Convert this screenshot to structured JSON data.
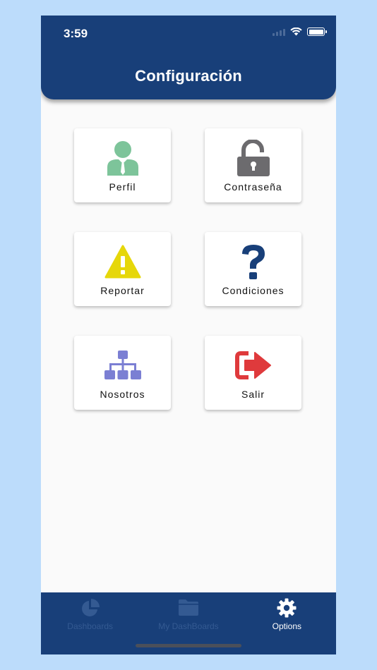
{
  "status_bar": {
    "time": "3:59"
  },
  "header": {
    "title": "Configuración"
  },
  "menu": [
    {
      "label": "Perfil",
      "icon": "user-icon",
      "color": "#7dc49a"
    },
    {
      "label": "Contraseña",
      "icon": "unlock-icon",
      "color": "#6c6b6e"
    },
    {
      "label": "Reportar",
      "icon": "warning-icon",
      "color": "#e6d70a"
    },
    {
      "label": "Condiciones",
      "icon": "question-icon",
      "color": "#183f79"
    },
    {
      "label": "Nosotros",
      "icon": "sitemap-icon",
      "color": "#7b7fd3"
    },
    {
      "label": "Salir",
      "icon": "logout-icon",
      "color": "#df3a3c"
    }
  ],
  "tabbar": {
    "tabs": [
      {
        "label": "Dashboards",
        "icon": "pie-chart-icon",
        "active": false
      },
      {
        "label": "My DashBoards",
        "icon": "folder-icon",
        "active": false
      },
      {
        "label": "Options",
        "icon": "gear-icon",
        "active": true
      }
    ]
  },
  "colors": {
    "primary": "#183f79",
    "background": "#bcdcfb",
    "surface": "#fafafa"
  }
}
